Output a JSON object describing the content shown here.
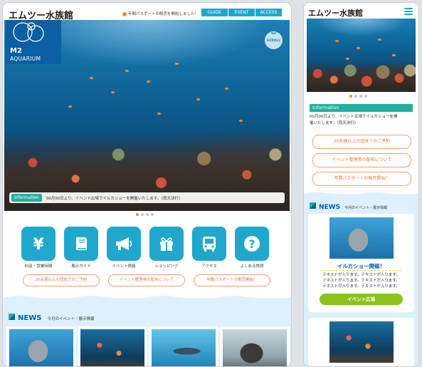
{
  "site": {
    "title": "エムツー水族館",
    "logo": {
      "line1": "M2",
      "line2": "AQUARIUM"
    }
  },
  "header": {
    "notice": "年間パスポートの販売を開始しました！",
    "nav": [
      "GUIDE",
      "EVENT",
      "ACCESS"
    ]
  },
  "hero": {
    "scroll_label": "SCROLL",
    "info_label": "Information",
    "info_text": "00月00日より、イベント広場でイルカショーを開催いたします。（雨天決行）"
  },
  "services": [
    {
      "icon": "yen-icon",
      "label": "料金・営業時間"
    },
    {
      "icon": "book-icon",
      "label": "展示ガイド"
    },
    {
      "icon": "megaphone-icon",
      "label": "イベント情報"
    },
    {
      "icon": "gift-icon",
      "label": "ショッピング"
    },
    {
      "icon": "bus-icon",
      "label": "アクセス"
    },
    {
      "icon": "question-icon",
      "label": "よくある質問"
    }
  ],
  "links": [
    "20名様以上の団体でのご予約",
    "イベント整理券の配布について",
    "年間パスポートの販売開始！"
  ],
  "news": {
    "title": "NEWS",
    "subtitle": "今月のイベント・展示情報"
  },
  "mobile": {
    "info_label": "Information",
    "info_text_line1": "00月00日より、イベント広場でイルカショーを開",
    "info_text_line2": "催いたします。（雨天決行）",
    "news_card": {
      "headline": "イルカショー開催！",
      "body": [
        "テキストが入ります。テキストが入ります。",
        "テキストが入ります。テキストが入ります。",
        "テキストが入ります。テキストが入ります。"
      ],
      "button": "イベント広場"
    }
  },
  "colors": {
    "primary": "#1fa8cc",
    "accent": "#ec7a3d",
    "info": "#22b1a0",
    "brand": "#0b5fa3",
    "cta": "#8cc21f"
  }
}
